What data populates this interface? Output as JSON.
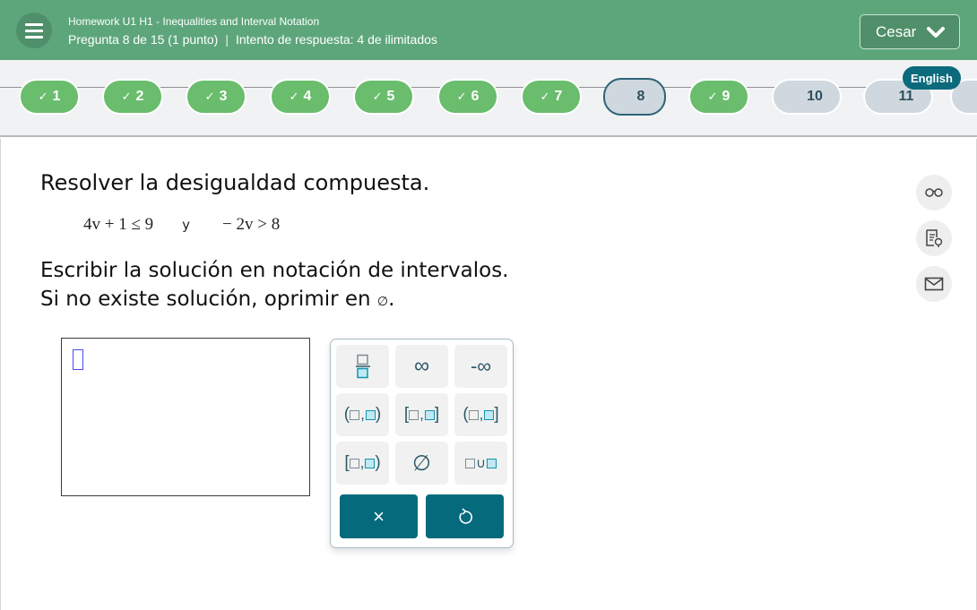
{
  "header": {
    "menu_icon": "hamburger-menu-icon",
    "assignment_title": "Homework U1 H1 - Inequalities and Interval Notation",
    "question_info": "Pregunta 8 de 15 (1 punto)",
    "separator": "|",
    "attempt_info": "Intento de respuesta: 4 de ilimitados",
    "user_name": "Cesar",
    "user_chevron_icon": "chevron-down-icon",
    "bg_color": "#5da67b"
  },
  "question_nav": {
    "language_label": "English",
    "items": [
      {
        "number": "1",
        "status": "correct",
        "check": "✓"
      },
      {
        "number": "2",
        "status": "correct",
        "check": "✓"
      },
      {
        "number": "3",
        "status": "correct",
        "check": "✓"
      },
      {
        "number": "4",
        "status": "correct",
        "check": "✓"
      },
      {
        "number": "5",
        "status": "correct",
        "check": "✓"
      },
      {
        "number": "6",
        "status": "correct",
        "check": "✓"
      },
      {
        "number": "7",
        "status": "correct",
        "check": "✓"
      },
      {
        "number": "8",
        "status": "current",
        "check": ""
      },
      {
        "number": "9",
        "status": "correct",
        "check": "✓"
      },
      {
        "number": "10",
        "status": "unanswered",
        "check": ""
      },
      {
        "number": "11",
        "status": "unanswered",
        "check": ""
      },
      {
        "number": "",
        "status": "unanswered",
        "check": ""
      }
    ],
    "colors": {
      "correct": "#69bd6d",
      "unanswered": "#cfd8de",
      "current_border": "#2f6379",
      "language_badge": "#0b6a7c"
    }
  },
  "question": {
    "title": "Resolver la desigualdad compuesta.",
    "inequality_1": "4v + 1 ≤ 9",
    "conjunction": "y",
    "inequality_2": "− 2v > 8",
    "instruction_line1": "Escribir la solución en notación de intervalos.",
    "instruction_line2_prefix": "Si no existe solución, oprimir en",
    "instruction_line2_symbol": "∅",
    "instruction_line2_suffix": "."
  },
  "side_tools": [
    {
      "icon": "glasses-icon",
      "label": "Ver ejemplo"
    },
    {
      "icon": "hint-document-icon",
      "label": "Ayuda"
    },
    {
      "icon": "mail-icon",
      "label": "Mensaje"
    }
  ],
  "answer": {
    "value": ""
  },
  "keypad": {
    "keys": [
      {
        "id": "fraction",
        "label": "fracción"
      },
      {
        "id": "infinity",
        "label": "∞"
      },
      {
        "id": "neg-infinity",
        "label": "-∞"
      },
      {
        "id": "open-open",
        "left": "(",
        "right": ")"
      },
      {
        "id": "closed-closed",
        "left": "[",
        "right": "]"
      },
      {
        "id": "open-closed",
        "left": "(",
        "right": "]"
      },
      {
        "id": "closed-open",
        "left": "[",
        "right": ")"
      },
      {
        "id": "empty-set",
        "label": "∅"
      },
      {
        "id": "union",
        "label": "∪"
      }
    ],
    "clear_label": "×",
    "undo_label": "↺",
    "action_color": "#046a7c"
  }
}
